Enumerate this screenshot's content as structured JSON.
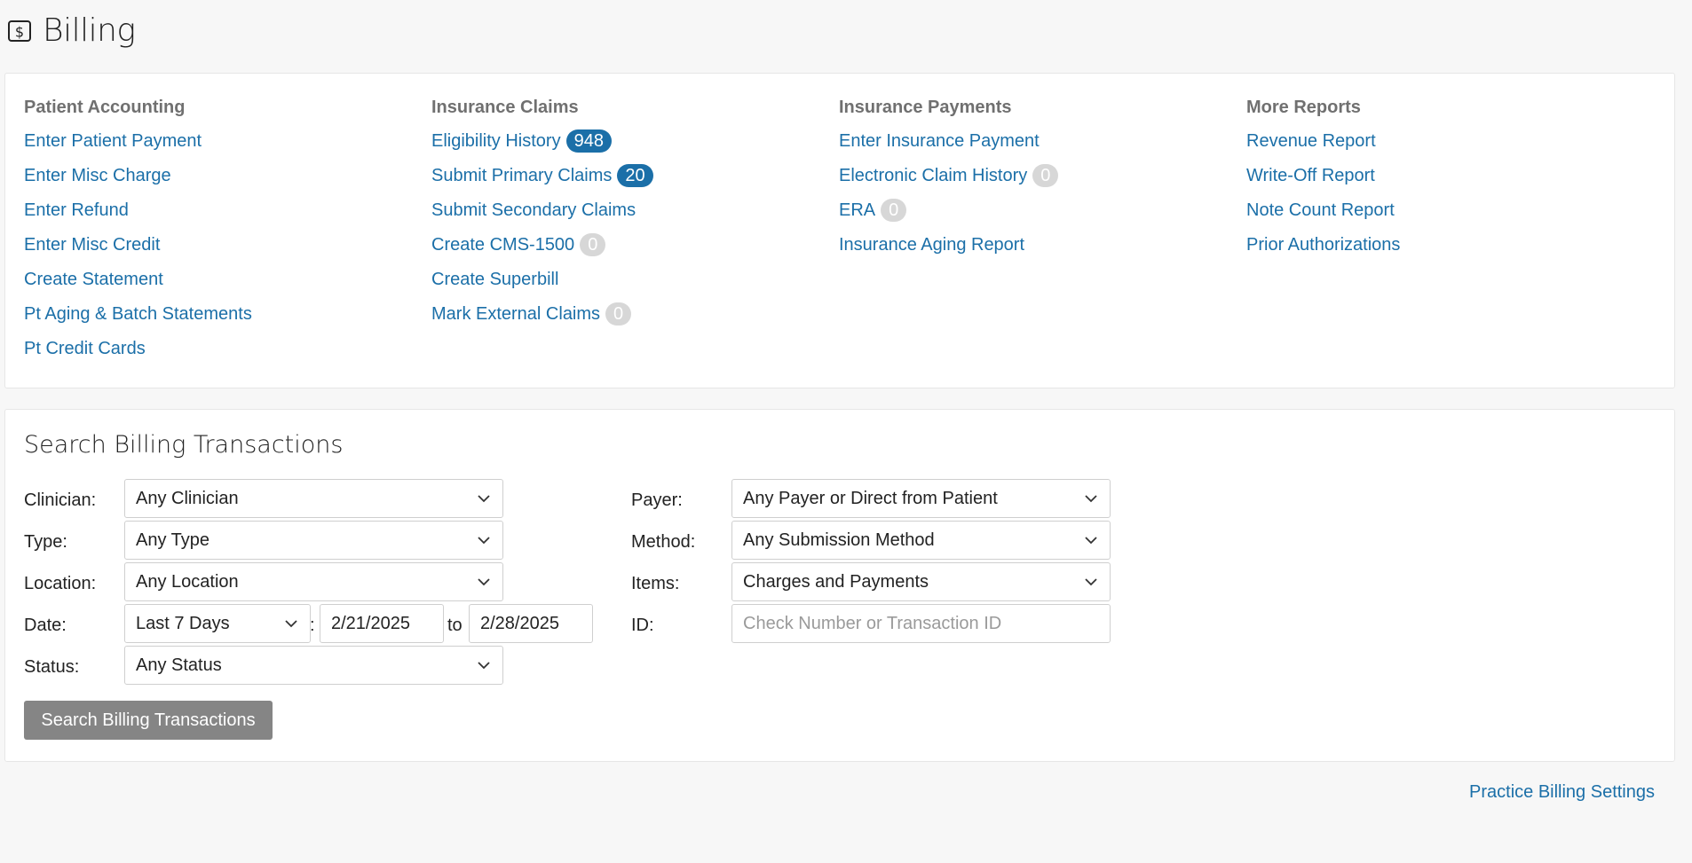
{
  "page": {
    "title": "Billing",
    "icon": "dollar-icon"
  },
  "columns": [
    {
      "heading": "Patient Accounting",
      "links": [
        {
          "label": "Enter Patient Payment"
        },
        {
          "label": "Enter Misc Charge"
        },
        {
          "label": "Enter Refund"
        },
        {
          "label": "Enter Misc Credit"
        },
        {
          "label": "Create Statement"
        },
        {
          "label": "Pt Aging & Batch Statements"
        },
        {
          "label": "Pt Credit Cards"
        }
      ]
    },
    {
      "heading": "Insurance Claims",
      "links": [
        {
          "label": "Eligibility History",
          "badge": "948",
          "badge_style": "blue"
        },
        {
          "label": "Submit Primary Claims",
          "badge": "20",
          "badge_style": "blue"
        },
        {
          "label": "Submit Secondary Claims"
        },
        {
          "label": "Create CMS-1500",
          "badge": "0",
          "badge_style": "gray"
        },
        {
          "label": "Create Superbill"
        },
        {
          "label": "Mark External Claims",
          "badge": "0",
          "badge_style": "gray"
        }
      ]
    },
    {
      "heading": "Insurance Payments",
      "links": [
        {
          "label": "Enter Insurance Payment"
        },
        {
          "label": "Electronic Claim History",
          "badge": "0",
          "badge_style": "gray"
        },
        {
          "label": "ERA",
          "badge": "0",
          "badge_style": "gray"
        },
        {
          "label": "Insurance Aging Report"
        }
      ]
    },
    {
      "heading": "More Reports",
      "links": [
        {
          "label": "Revenue Report"
        },
        {
          "label": "Write-Off Report"
        },
        {
          "label": "Note Count Report"
        },
        {
          "label": "Prior Authorizations"
        }
      ]
    }
  ],
  "search": {
    "title": "Search Billing Transactions",
    "clinician": {
      "label": "Clinician:",
      "value": "Any Clinician"
    },
    "type": {
      "label": "Type:",
      "value": "Any Type"
    },
    "location": {
      "label": "Location:",
      "value": "Any Location"
    },
    "date": {
      "label": "Date:",
      "range": "Last 7 Days",
      "sep": ":",
      "from": "2/21/2025",
      "to_label": "to",
      "to": "2/28/2025"
    },
    "status": {
      "label": "Status:",
      "value": "Any Status"
    },
    "payer": {
      "label": "Payer:",
      "value": "Any Payer or Direct from Patient"
    },
    "method": {
      "label": "Method:",
      "value": "Any Submission Method"
    },
    "items": {
      "label": "Items:",
      "value": "Charges and Payments"
    },
    "id": {
      "label": "ID:",
      "placeholder": "Check Number or Transaction ID"
    },
    "button_label": "Search Billing Transactions"
  },
  "footer": {
    "settings_link": "Practice Billing Settings"
  },
  "colors": {
    "link": "#1b6fa8",
    "badge_active": "#1b6fa8",
    "badge_inactive": "#d7d7d7",
    "button": "#858585"
  }
}
